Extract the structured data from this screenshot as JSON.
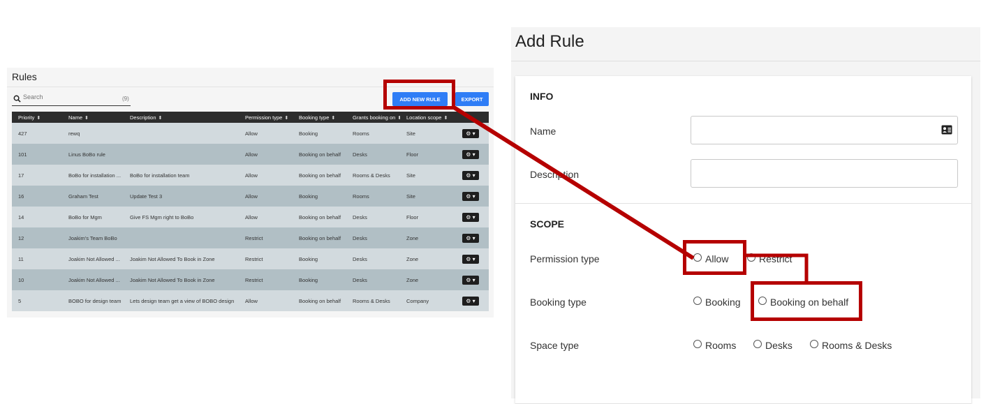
{
  "rules_panel": {
    "title": "Rules",
    "search": {
      "placeholder": "Search",
      "value": "",
      "count": "(9)"
    },
    "buttons": {
      "add_new_rule": "ADD NEW RULE",
      "export": "EXPORT"
    },
    "columns": [
      "Priority",
      "Name",
      "Description",
      "Permission type",
      "Booking type",
      "Grants booking on",
      "Location scope"
    ],
    "rows": [
      {
        "priority": "427",
        "name": "rewq",
        "description": "",
        "permission": "Allow",
        "booking": "Booking",
        "grants": "Rooms",
        "scope": "Site"
      },
      {
        "priority": "101",
        "name": "Linus BoBo rule",
        "description": "",
        "permission": "Allow",
        "booking": "Booking on behalf",
        "grants": "Desks",
        "scope": "Floor"
      },
      {
        "priority": "17",
        "name": "BoBo for installation ...",
        "description": "BoBo for installation team",
        "permission": "Allow",
        "booking": "Booking on behalf",
        "grants": "Rooms & Desks",
        "scope": "Site"
      },
      {
        "priority": "16",
        "name": "Graham Test",
        "description": "Update Test 3",
        "permission": "Allow",
        "booking": "Booking",
        "grants": "Rooms",
        "scope": "Site"
      },
      {
        "priority": "14",
        "name": "BoBo for Mgm",
        "description": "Give FS Mgm right to BoBo",
        "permission": "Allow",
        "booking": "Booking on behalf",
        "grants": "Desks",
        "scope": "Floor"
      },
      {
        "priority": "12",
        "name": "Joakim's Team BoBo",
        "description": "",
        "permission": "Restrict",
        "booking": "Booking on behalf",
        "grants": "Desks",
        "scope": "Zone"
      },
      {
        "priority": "11",
        "name": "Joakim Not Allowed ...",
        "description": "Joakim Not Allowed To Book in Zone",
        "permission": "Restrict",
        "booking": "Booking",
        "grants": "Desks",
        "scope": "Zone"
      },
      {
        "priority": "10",
        "name": "Joakim Not Allowed ...",
        "description": "Joakim Not Allowed To Book in Zone",
        "permission": "Restrict",
        "booking": "Booking",
        "grants": "Desks",
        "scope": "Zone"
      },
      {
        "priority": "5",
        "name": "BOBO for design team",
        "description": "Lets design team get a view of BOBO design",
        "permission": "Allow",
        "booking": "Booking on behalf",
        "grants": "Rooms & Desks",
        "scope": "Company"
      }
    ]
  },
  "add_rule": {
    "title": "Add Rule",
    "info": {
      "heading": "INFO",
      "name_label": "Name",
      "name_value": "",
      "description_label": "Description",
      "description_value": ""
    },
    "scope": {
      "heading": "SCOPE",
      "permission_type": {
        "label": "Permission type",
        "options": [
          "Allow",
          "Restrict"
        ]
      },
      "booking_type": {
        "label": "Booking type",
        "options": [
          "Booking",
          "Booking on behalf"
        ]
      },
      "space_type": {
        "label": "Space type",
        "options": [
          "Rooms",
          "Desks",
          "Rooms & Desks"
        ]
      }
    }
  },
  "icons": {
    "search": "search-icon",
    "sort": "sort-icon",
    "row_actions": "gear-icon",
    "name_field": "contact-card-icon"
  },
  "colors": {
    "primary_button": "#2f7df6",
    "table_header": "#2d2d2d",
    "row_light": "#d2dade",
    "row_dark": "#b1bfc5",
    "annotation": "#b50000"
  }
}
